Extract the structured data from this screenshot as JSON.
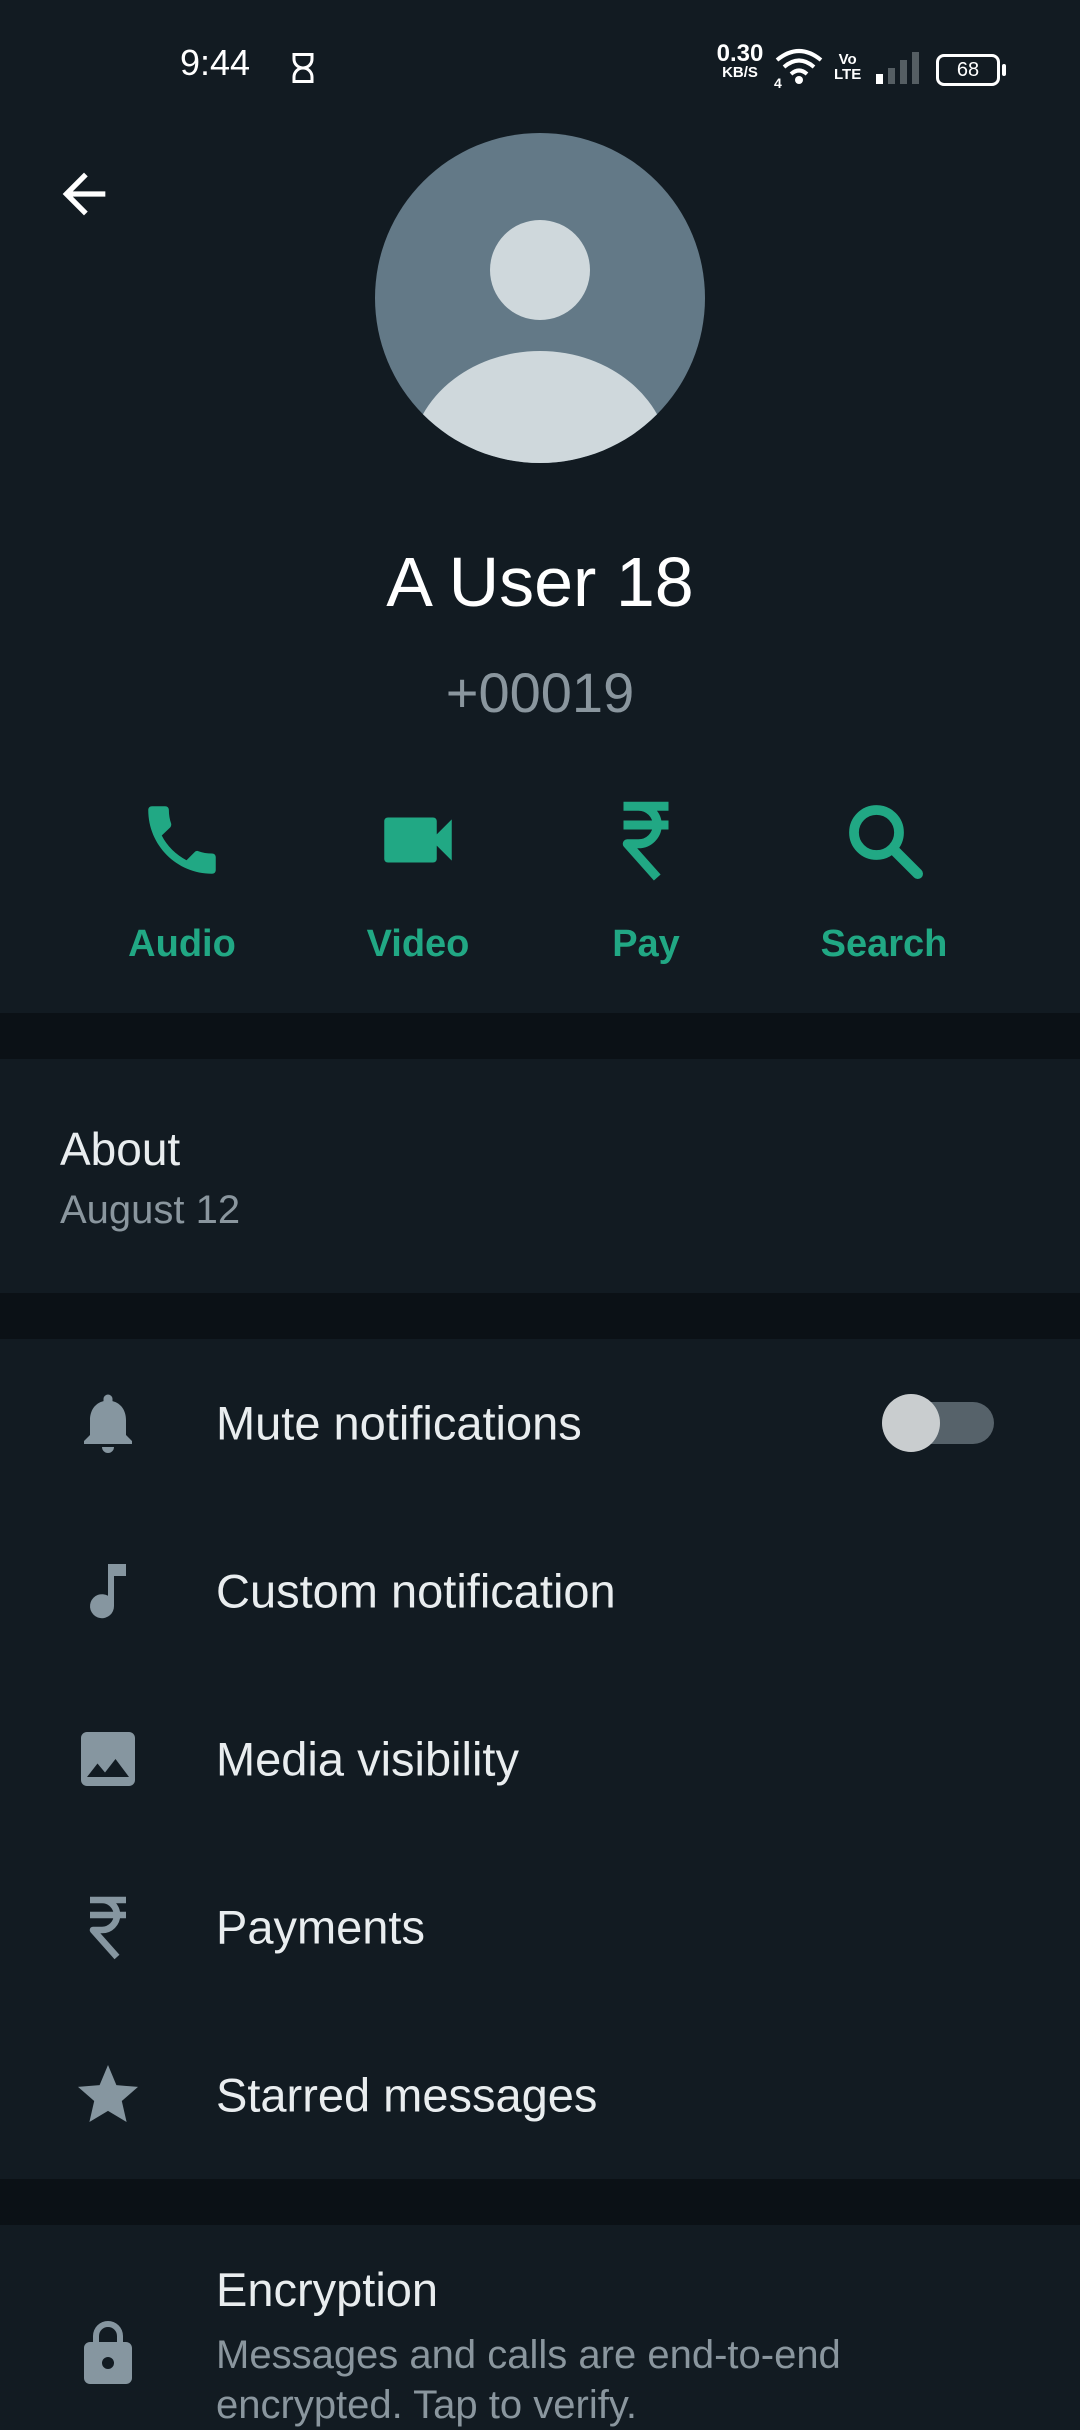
{
  "status_bar": {
    "time": "9:44",
    "data_speed_value": "0.30",
    "data_speed_unit": "KB/S",
    "network_type": "4",
    "volte_top": "Vo",
    "volte_bottom": "LTE",
    "battery": "68"
  },
  "contact": {
    "name": "A User 18",
    "phone": "+00019"
  },
  "actions": [
    {
      "label": "Audio",
      "icon": "phone-icon"
    },
    {
      "label": "Video",
      "icon": "videocam-icon"
    },
    {
      "label": "Pay",
      "icon": "rupee-icon"
    },
    {
      "label": "Search",
      "icon": "search-icon"
    }
  ],
  "about": {
    "title": "About",
    "value": "August 12"
  },
  "settings": [
    {
      "label": "Mute notifications",
      "icon": "bell-icon",
      "toggle_on": false
    },
    {
      "label": "Custom notification",
      "icon": "music-note-icon"
    },
    {
      "label": "Media visibility",
      "icon": "image-icon"
    },
    {
      "label": "Payments",
      "icon": "rupee-icon"
    },
    {
      "label": "Starred messages",
      "icon": "star-icon"
    }
  ],
  "encryption": {
    "title": "Encryption",
    "subtitle": "Messages and calls are end-to-end encrypted. Tap to verify."
  },
  "colors": {
    "accent": "#21a884",
    "background": "#121b22",
    "divider": "#0b1116",
    "icon_gray": "#8696a0"
  }
}
